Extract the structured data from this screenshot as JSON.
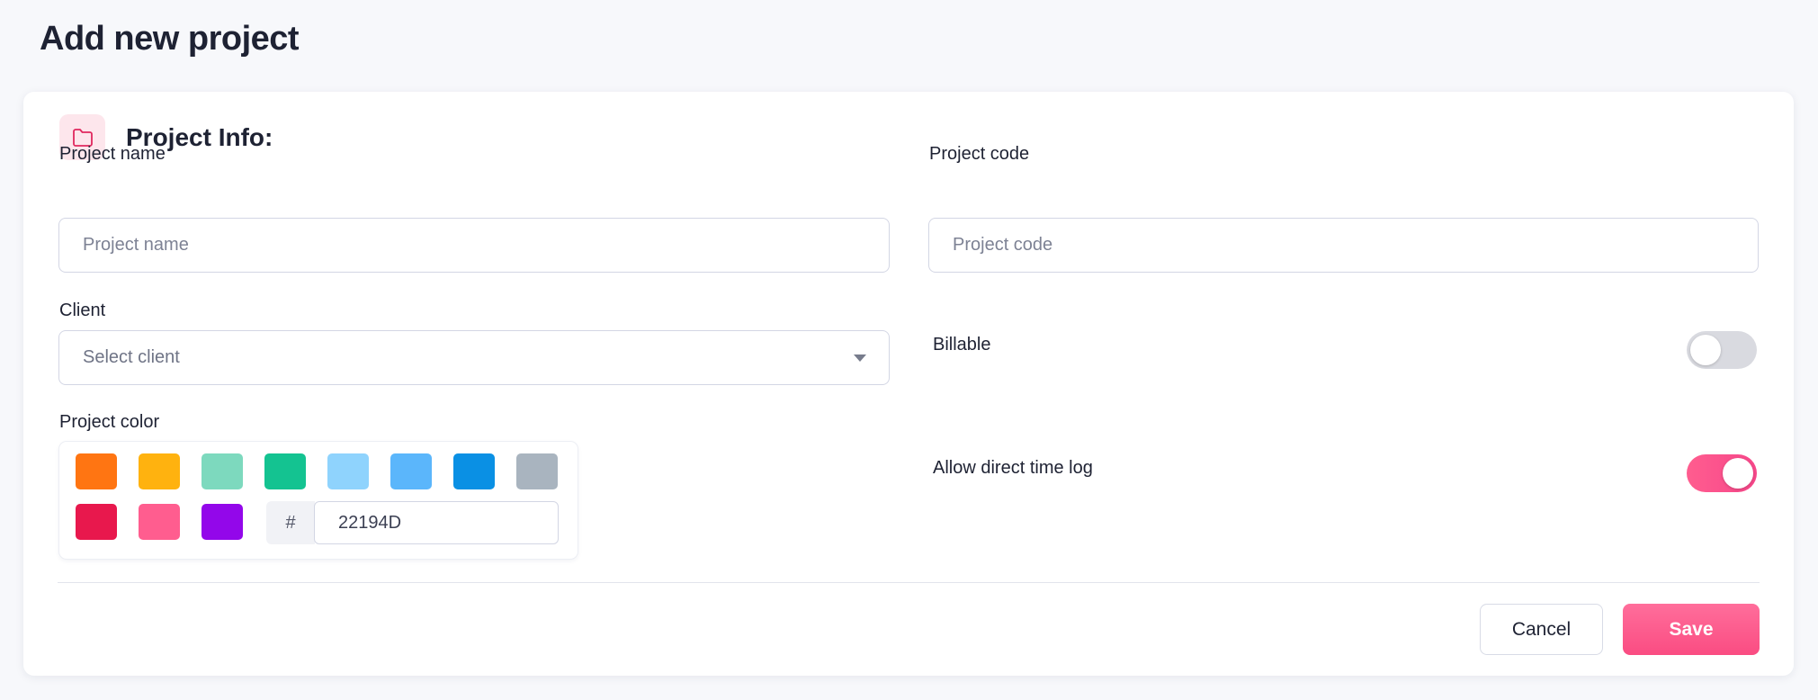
{
  "page": {
    "title": "Add new project"
  },
  "section": {
    "title": "Project Info:",
    "icon": "folder-icon"
  },
  "fields": {
    "project_name": {
      "label": "Project name",
      "placeholder": "Project name",
      "value": ""
    },
    "project_code": {
      "label": "Project code",
      "placeholder": "Project code",
      "value": ""
    },
    "client": {
      "label": "Client",
      "placeholder": "Select client"
    },
    "billable": {
      "label": "Billable",
      "on": false
    },
    "project_color": {
      "label": "Project color",
      "swatches": [
        "#FF7512",
        "#FFB20F",
        "#7DD9BE",
        "#14C391",
        "#8FD3FD",
        "#5BB6FB",
        "#0A90E4",
        "#A9B4BF",
        "#E8184D",
        "#FF5D8F",
        "#9307EA"
      ],
      "hash_symbol": "#",
      "hex_value": "22194D"
    },
    "allow_direct_time_log": {
      "label": "Allow direct time log",
      "on": true
    }
  },
  "actions": {
    "cancel_label": "Cancel",
    "save_label": "Save"
  },
  "colors": {
    "accent": "#FA4C82",
    "icon_bg": "#FDE6EC",
    "border": "#D3D6E4"
  }
}
